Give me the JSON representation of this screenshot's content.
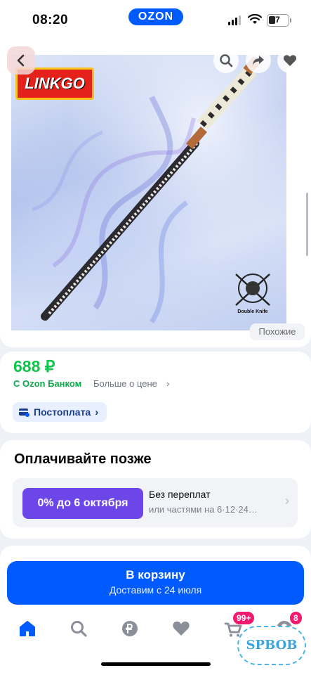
{
  "status_bar": {
    "time": "08:20",
    "app_logo": "OZON",
    "battery_level": "7"
  },
  "product": {
    "brand_logo_text": "LINKGO",
    "emblem_text": "Double Knife",
    "similar_label": "Похожие",
    "icons": [
      "back-chevron-icon",
      "search-icon",
      "share-icon",
      "heart-icon"
    ]
  },
  "price_section": {
    "price": "688 ₽",
    "bank_label": "С Ozon Банком",
    "more_price_label": "Больше о цене",
    "postpay_label": "Постоплата"
  },
  "pay_later": {
    "title": "Оплачивайте позже",
    "installment_badge": "0% до 6 октября",
    "no_overpay": "Без переплат",
    "installments_note": "или частями на 6·12·24…"
  },
  "cart": {
    "button_label": "В корзину",
    "delivery_note": "Доставим с 24 июля"
  },
  "bottom_nav": {
    "items": [
      "home-icon",
      "search-icon",
      "ruble-icon",
      "heart-icon",
      "cart-icon",
      "profile-icon"
    ],
    "cart_badge": "99+",
    "profile_badge": "8"
  },
  "watermark": "SPBOB",
  "colors": {
    "accent": "#005bff",
    "price_green": "#10c44c",
    "installment_purple": "#6c46e8",
    "badge_pink": "#f11a6e"
  }
}
